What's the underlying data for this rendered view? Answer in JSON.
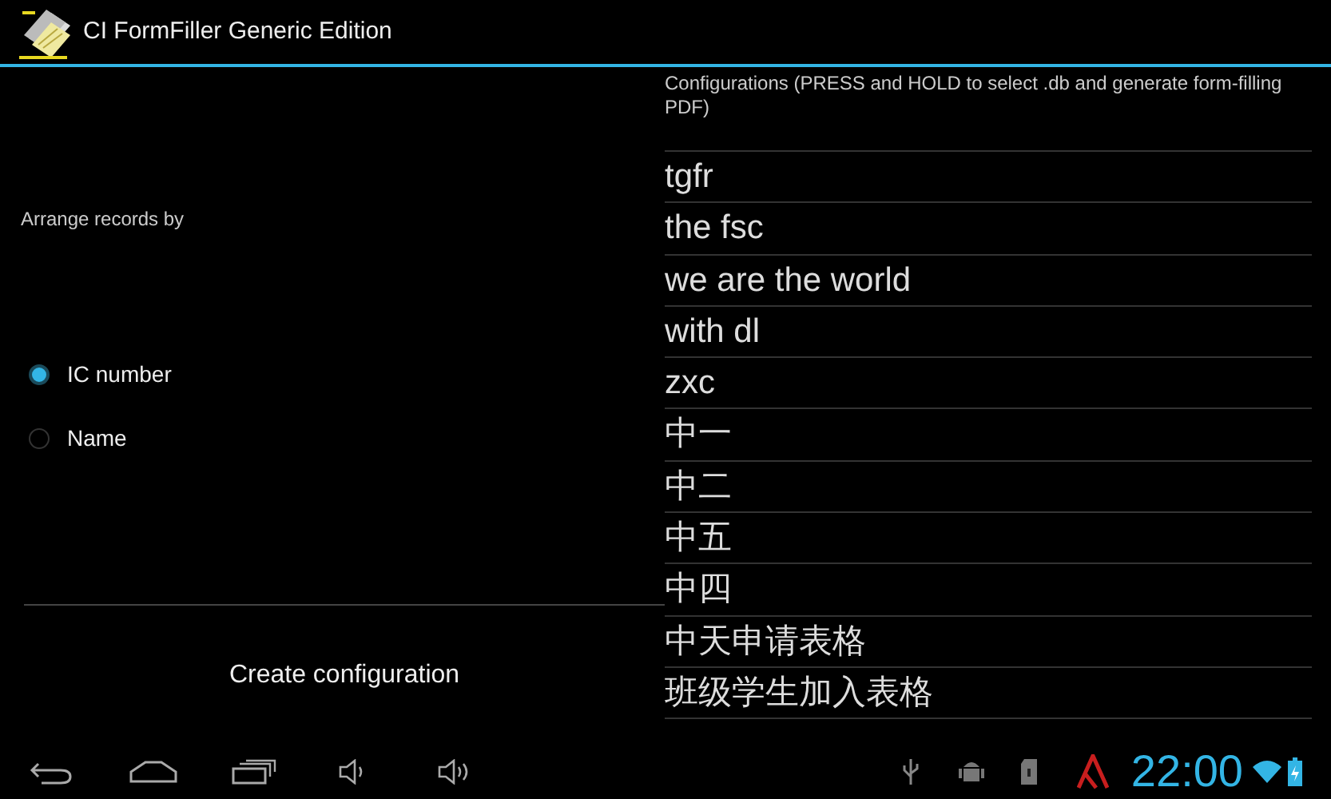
{
  "app_bar": {
    "title": "CI FormFiller Generic Edition"
  },
  "left_panel": {
    "label": "Arrange records by",
    "options": [
      {
        "label": "IC number",
        "selected": true
      },
      {
        "label": "Name",
        "selected": false
      }
    ],
    "button": "Create configuration"
  },
  "configurations": {
    "header": "Configurations (PRESS and HOLD to select .db and generate form-filling PDF)",
    "items": [
      "tgfr",
      "the fsc",
      "we are the world",
      "with dl",
      "zxc",
      "中一",
      "中二",
      "中五",
      "中四",
      "中天申请表格",
      "班级学生加入表格"
    ]
  },
  "status_bar": {
    "time": "22:00"
  }
}
